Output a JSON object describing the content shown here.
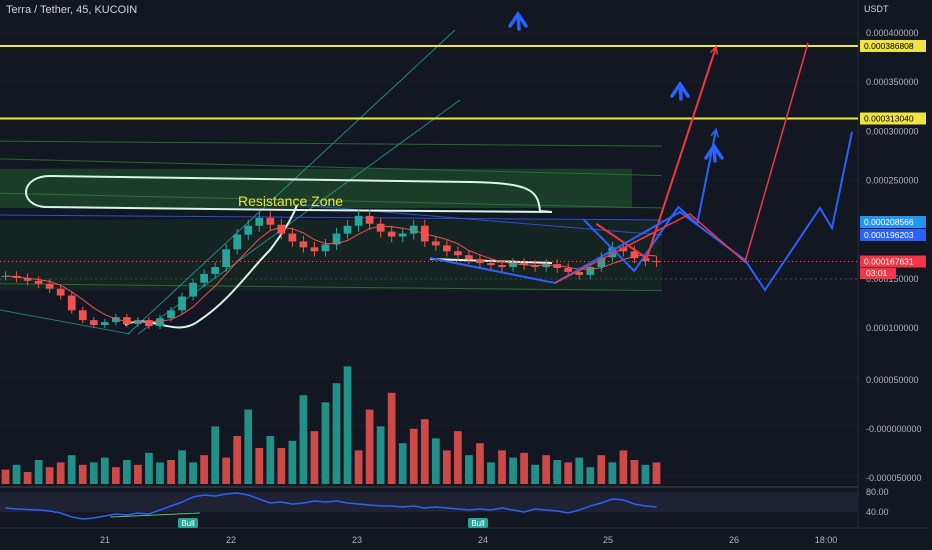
{
  "header": {
    "title": "Terra / Tether, 45, KUCOIN",
    "currency": "USDT"
  },
  "chart_data": [
    {
      "type": "candlestick",
      "title": "Terra / Tether, 45, KUCOIN",
      "xlabel": "",
      "ylabel": "",
      "unit": "USDT",
      "ylim": [
        5e-05,
        0.00041
      ],
      "ticks": {
        "y": [
          "0.000400000",
          "0.000350000",
          "0.000300000",
          "0.000250000",
          "0.000150000",
          "0.000100000",
          "0.000050000",
          "-0.000000000",
          "-0.000050000"
        ],
        "x": [
          "21",
          "22",
          "23",
          "24",
          "25",
          "26",
          "18:00"
        ]
      },
      "price_labels": [
        {
          "text": "0.000386808",
          "value": 0.000386808,
          "color": "#f0e442"
        },
        {
          "text": "0.000313040",
          "value": 0.00031304,
          "color": "#f0e442"
        },
        {
          "text": "0.000208566",
          "value": 0.000208566,
          "color": "#2196f3"
        },
        {
          "text": "0.000196203",
          "value": 0.000196203,
          "color": "#2962ff"
        },
        {
          "text": "0.000167631",
          "value": 0.000167631,
          "color": "#f23645"
        }
      ],
      "countdown": "03:01",
      "horizontal_levels": [
        0.000386808,
        0.00031304
      ],
      "annotations": [
        {
          "text": "Resistance Zone",
          "color": "#f0e442"
        }
      ],
      "close": [
        0.000153,
        0.000151,
        0.000148,
        0.000145,
        0.00014,
        0.000133,
        0.000118,
        0.000108,
        0.000103,
        0.000106,
        0.000111,
        0.000104,
        0.000108,
        0.000102,
        0.00011,
        0.000118,
        0.000132,
        0.000146,
        0.000155,
        0.000162,
        0.00018,
        0.000195,
        0.000204,
        0.000212,
        0.000205,
        0.000196,
        0.000188,
        0.000182,
        0.000178,
        0.000185,
        0.000196,
        0.000204,
        0.000214,
        0.000206,
        0.000198,
        0.000193,
        0.000196,
        0.000204,
        0.000188,
        0.000184,
        0.000178,
        0.000174,
        0.00017,
        0.000166,
        0.000164,
        0.000162,
        0.000166,
        0.000164,
        0.000162,
        0.000165,
        0.000161,
        0.000157,
        0.000154,
        0.000162,
        0.000172,
        0.000182,
        0.000178,
        0.000171,
        0.000168,
        0.000167
      ],
      "projections": [
        {
          "name": "",
          "color": "#2962ff",
          "points": [
            [
              5.8,
              0.00021
            ],
            [
              6.2,
              0.000158
            ],
            [
              6.55,
              0.000223
            ],
            [
              6.7,
              0.000206
            ],
            [
              6.85,
              0.000302
            ]
          ]
        },
        {
          "name": "",
          "color": "#f23645",
          "points": [
            [
              5.9,
              0.000206
            ],
            [
              6.3,
              0.000171
            ],
            [
              6.85,
              0.000386
            ]
          ]
        }
      ],
      "volume": [
        6,
        8,
        5,
        10,
        7,
        9,
        12,
        8,
        9,
        11,
        7,
        10,
        8,
        13,
        9,
        10,
        14,
        9,
        12,
        24,
        11,
        20,
        31,
        15,
        20,
        15,
        18,
        37,
        22,
        34,
        42,
        49,
        14,
        31,
        24,
        38,
        17,
        23,
        27,
        19,
        14,
        22,
        12,
        17,
        9,
        14,
        11,
        13,
        8,
        12,
        10,
        9,
        11,
        7,
        12,
        9,
        14,
        10,
        8,
        9
      ],
      "volume_colors": [
        "r",
        "g",
        "r",
        "g",
        "r",
        "r",
        "g",
        "r",
        "g",
        "g",
        "r",
        "g",
        "r",
        "g",
        "g",
        "r",
        "g",
        "g",
        "r",
        "g",
        "r",
        "r",
        "g",
        "r",
        "g",
        "r",
        "g",
        "g",
        "r",
        "g",
        "g",
        "g",
        "r",
        "r",
        "g",
        "r",
        "g",
        "r",
        "r",
        "g",
        "r",
        "r",
        "g",
        "r",
        "g",
        "r",
        "g",
        "r",
        "g",
        "r",
        "g",
        "r",
        "g",
        "g",
        "r",
        "g",
        "r",
        "r",
        "g",
        "r"
      ],
      "rsi": {
        "ticks": [
          "80.00",
          "40.00"
        ],
        "labels": [
          "Bull",
          "Bull"
        ],
        "values": [
          48,
          46,
          45,
          44,
          42,
          38,
          30,
          26,
          28,
          32,
          36,
          34,
          38,
          36,
          44,
          52,
          60,
          70,
          74,
          72,
          76,
          78,
          74,
          66,
          58,
          60,
          56,
          58,
          62,
          60,
          62,
          58,
          56,
          54,
          52,
          52,
          50,
          52,
          48,
          50,
          48,
          46,
          44,
          46,
          44,
          48,
          44,
          40,
          46,
          44,
          42,
          38,
          44,
          52,
          58,
          66,
          64,
          56,
          52,
          50
        ]
      }
    }
  ]
}
